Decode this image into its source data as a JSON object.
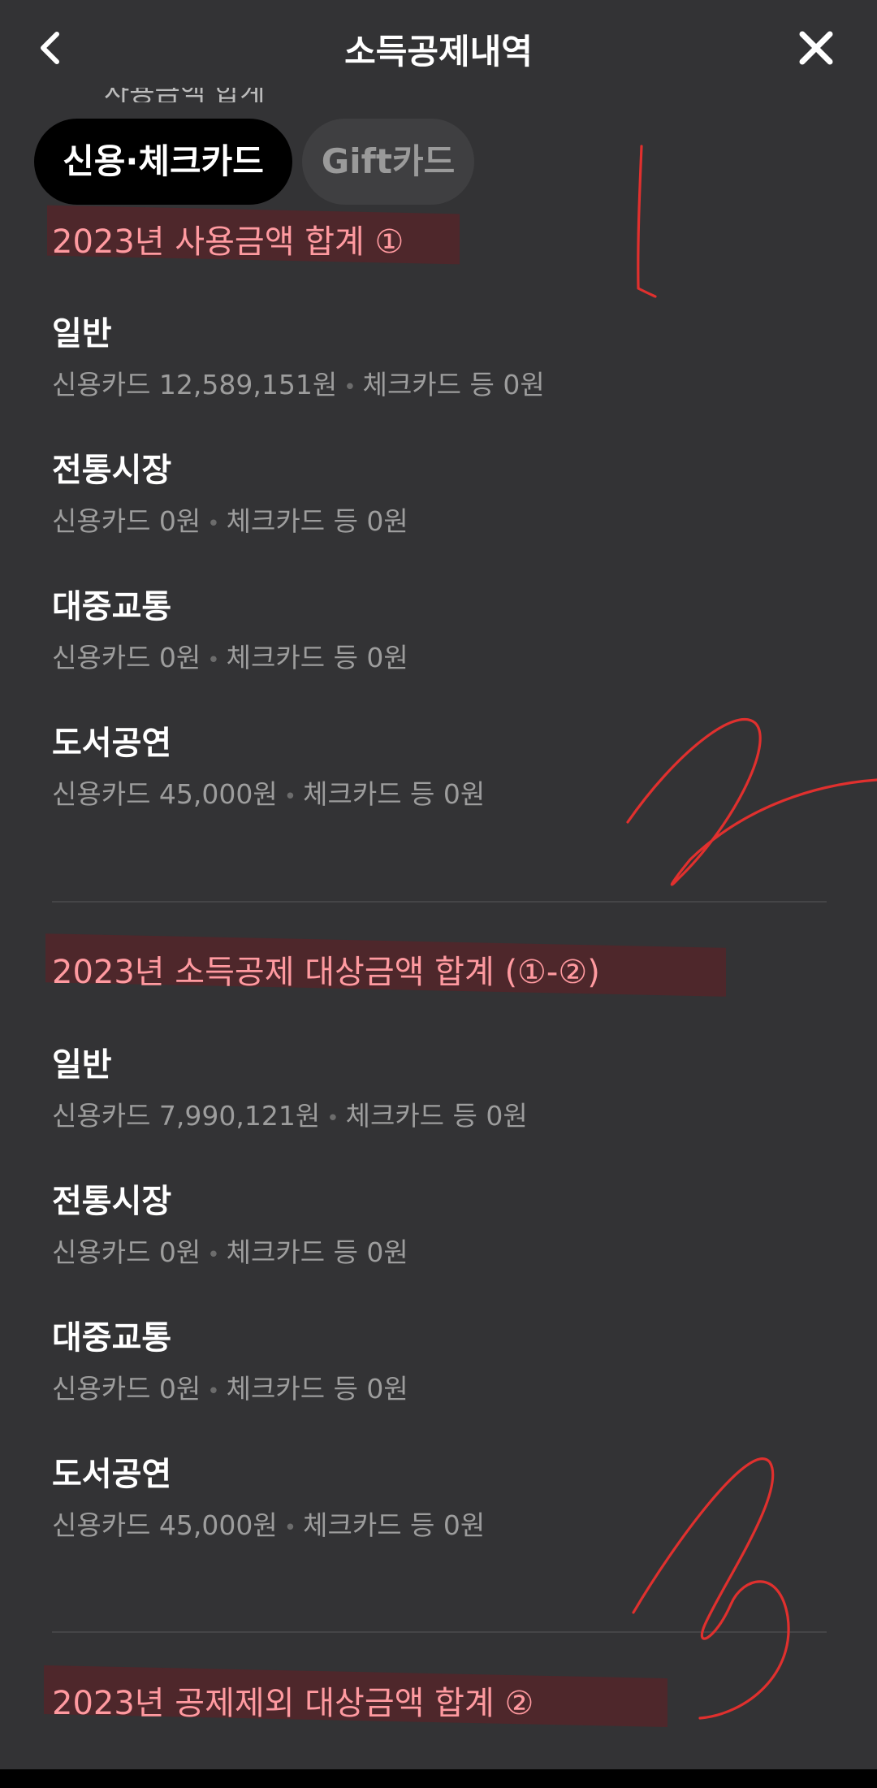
{
  "header": {
    "title": "소득공제내역",
    "back_icon": "chevron-left-icon",
    "close_icon": "close-icon"
  },
  "partial_text": "사용금액 합계",
  "tabs": [
    {
      "label": "신용·체크카드",
      "active": true
    },
    {
      "label": "Gift카드",
      "active": false
    }
  ],
  "sections": [
    {
      "title": "2023년 사용금액 합계 ①",
      "items": [
        {
          "label": "일반",
          "credit": "신용카드 12,589,151원",
          "check": "체크카드 등 0원"
        },
        {
          "label": "전통시장",
          "credit": "신용카드 0원",
          "check": "체크카드 등 0원"
        },
        {
          "label": "대중교통",
          "credit": "신용카드 0원",
          "check": "체크카드 등 0원"
        },
        {
          "label": "도서공연",
          "credit": "신용카드 45,000원",
          "check": "체크카드 등 0원"
        }
      ]
    },
    {
      "title": "2023년 소득공제 대상금액 합계 (①-②)",
      "items": [
        {
          "label": "일반",
          "credit": "신용카드 7,990,121원",
          "check": "체크카드 등 0원"
        },
        {
          "label": "전통시장",
          "credit": "신용카드 0원",
          "check": "체크카드 등 0원"
        },
        {
          "label": "대중교통",
          "credit": "신용카드 0원",
          "check": "체크카드 등 0원"
        },
        {
          "label": "도서공연",
          "credit": "신용카드 45,000원",
          "check": "체크카드 등 0원"
        }
      ]
    },
    {
      "title": "2023년 공제제외 대상금액 합계 ②",
      "items": []
    }
  ],
  "colors": {
    "background": "#333335",
    "section_title": "#ff9aa0",
    "highlight": "#6e191e",
    "detail_text": "#9d9d9d",
    "scribble": "#e0302e"
  }
}
